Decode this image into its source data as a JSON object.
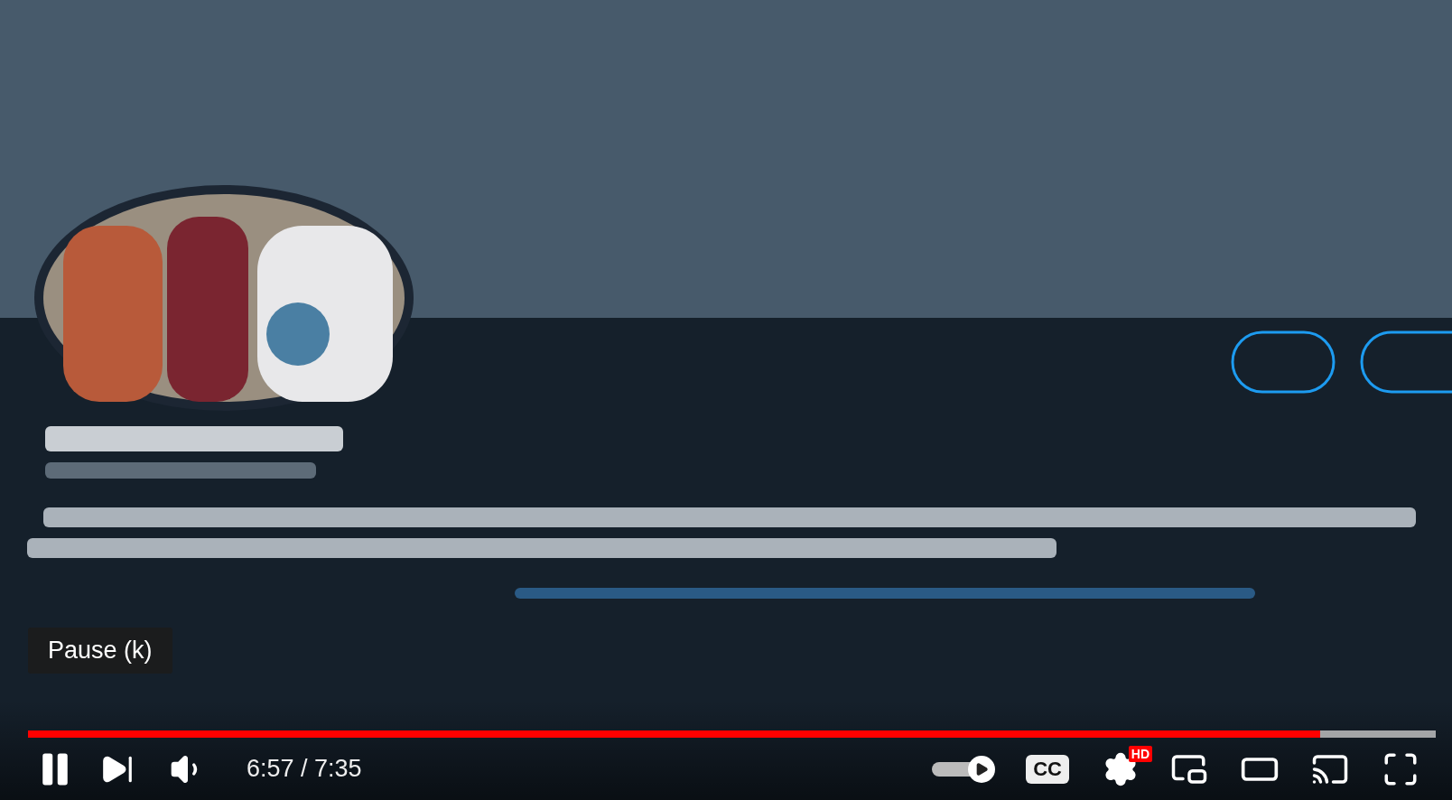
{
  "player": {
    "playing": true,
    "tooltip": "Pause (k)",
    "progress": {
      "level": 0.918
    },
    "time": "6:57 / 7:35",
    "autoplay": {
      "on": true
    },
    "captions": {
      "label": "CC",
      "on": false
    },
    "settings": {
      "badge": "HD"
    }
  }
}
